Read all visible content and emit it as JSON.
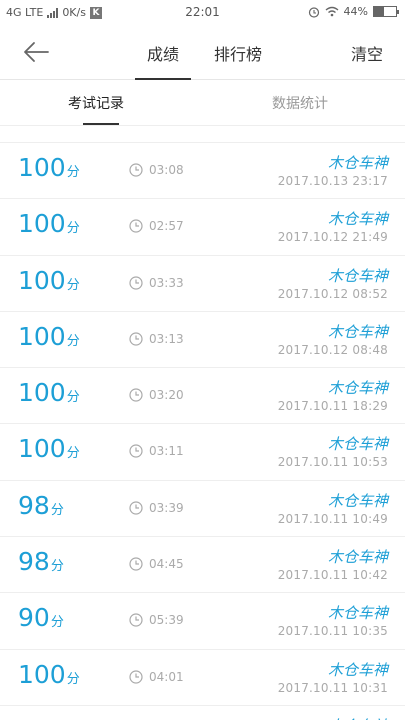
{
  "status_bar": {
    "network": "4G LTE",
    "speed": "0K/s",
    "k_badge": "K",
    "time": "22:01",
    "battery": "44%",
    "battery_level": 0.44
  },
  "header": {
    "tabs": [
      {
        "label": "成绩"
      },
      {
        "label": "排行榜"
      }
    ],
    "clear_label": "清空"
  },
  "subtabs": [
    {
      "label": "考试记录"
    },
    {
      "label": "数据统计"
    }
  ],
  "records": [
    {
      "score": "100",
      "unit": "分",
      "duration": "03:08",
      "name": "木仓车神",
      "datetime": "2017.10.13  23:17"
    },
    {
      "score": "100",
      "unit": "分",
      "duration": "02:57",
      "name": "木仓车神",
      "datetime": "2017.10.12  21:49"
    },
    {
      "score": "100",
      "unit": "分",
      "duration": "03:33",
      "name": "木仓车神",
      "datetime": "2017.10.12  08:52"
    },
    {
      "score": "100",
      "unit": "分",
      "duration": "03:13",
      "name": "木仓车神",
      "datetime": "2017.10.12  08:48"
    },
    {
      "score": "100",
      "unit": "分",
      "duration": "03:20",
      "name": "木仓车神",
      "datetime": "2017.10.11  18:29"
    },
    {
      "score": "100",
      "unit": "分",
      "duration": "03:11",
      "name": "木仓车神",
      "datetime": "2017.10.11  10:53"
    },
    {
      "score": "98",
      "unit": "分",
      "duration": "03:39",
      "name": "木仓车神",
      "datetime": "2017.10.11  10:49"
    },
    {
      "score": "98",
      "unit": "分",
      "duration": "04:45",
      "name": "木仓车神",
      "datetime": "2017.10.11  10:42"
    },
    {
      "score": "90",
      "unit": "分",
      "duration": "05:39",
      "name": "木仓车神",
      "datetime": "2017.10.11  10:35"
    },
    {
      "score": "100",
      "unit": "分",
      "duration": "04:01",
      "name": "木仓车神",
      "datetime": "2017.10.11  10:31"
    }
  ],
  "partial_record": {
    "name": "木仓车神"
  }
}
